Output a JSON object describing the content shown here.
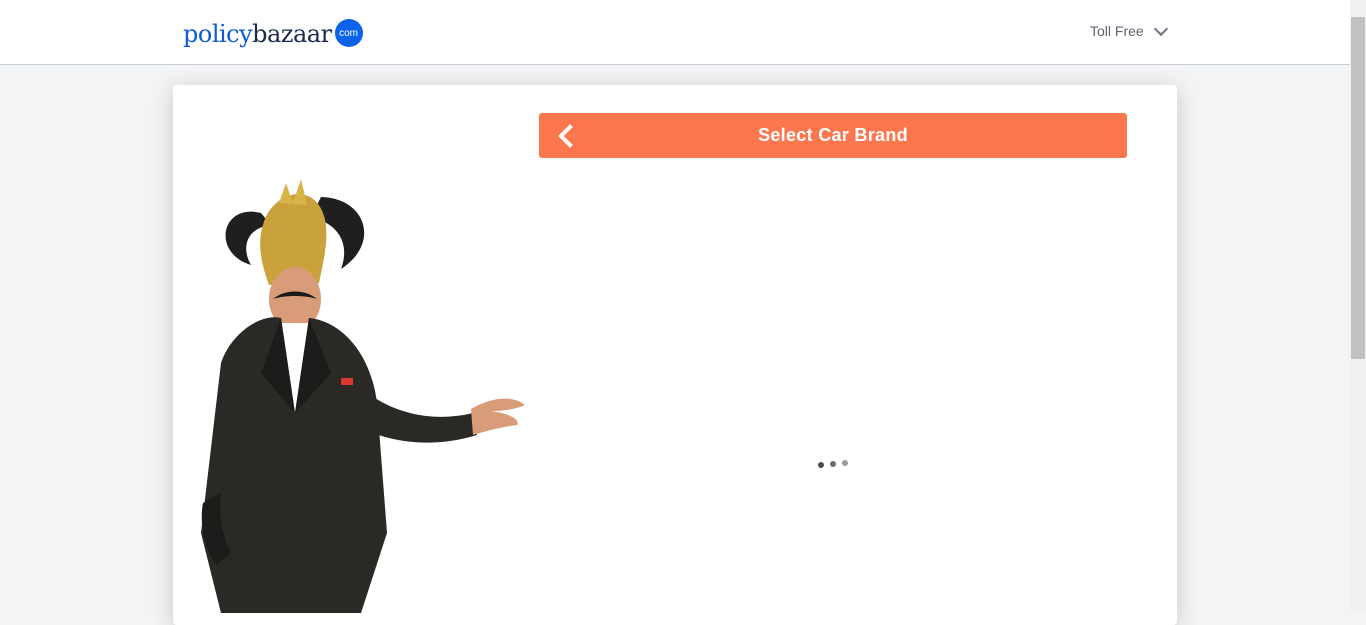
{
  "header": {
    "logo": {
      "part1": "policy",
      "part2": "bazaar",
      "badge": "com"
    },
    "toll_free_label": "Toll Free"
  },
  "main": {
    "title": "Select Car Brand"
  },
  "colors": {
    "accent": "#fd774e",
    "brand_blue": "#0a63e8"
  },
  "icons": {
    "back": "chevron-left-icon",
    "dropdown": "chevron-down-icon"
  }
}
